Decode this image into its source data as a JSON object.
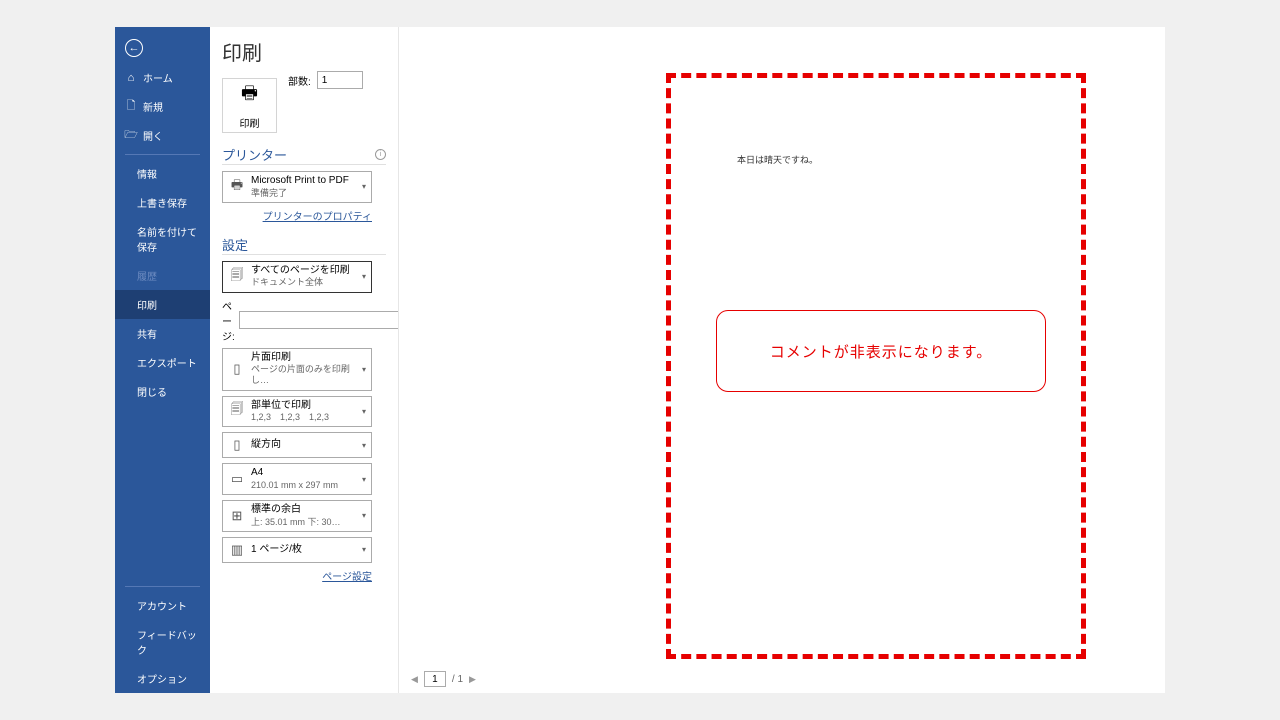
{
  "pageTitle": "印刷",
  "sidebar": {
    "home": "ホーム",
    "new": "新規",
    "open": "開く",
    "info": "情報",
    "save": "上書き保存",
    "saveAs": "名前を付けて保存",
    "history": "履歴",
    "print": "印刷",
    "share": "共有",
    "export": "エクスポート",
    "close": "閉じる",
    "account": "アカウント",
    "feedback": "フィードバック",
    "options": "オプション"
  },
  "printButton": {
    "label": "印刷"
  },
  "copies": {
    "label": "部数:",
    "value": "1"
  },
  "printerSection": {
    "title": "プリンター",
    "name": "Microsoft Print to PDF",
    "status": "準備完了",
    "propertiesLink": "プリンターのプロパティ"
  },
  "settingsSection": {
    "title": "設定",
    "pageSetupLink": "ページ設定",
    "pagesLabel": "ページ:",
    "options": [
      {
        "title": "すべてのページを印刷",
        "sub": "ドキュメント全体"
      },
      {
        "title": "片面印刷",
        "sub": "ページの片面のみを印刷し…"
      },
      {
        "title": "部単位で印刷",
        "sub": "1,2,3　1,2,3　1,2,3"
      },
      {
        "title": "縦方向",
        "sub": ""
      },
      {
        "title": "A4",
        "sub": "210.01 mm x 297 mm"
      },
      {
        "title": "標準の余白",
        "sub": "上: 35.01 mm 下: 30…"
      },
      {
        "title": "1 ページ/枚",
        "sub": ""
      }
    ]
  },
  "preview": {
    "documentText": "本日は晴天ですね。",
    "calloutText": "コメントが非表示になります。"
  },
  "pageNav": {
    "current": "1",
    "total": "/ 1"
  }
}
